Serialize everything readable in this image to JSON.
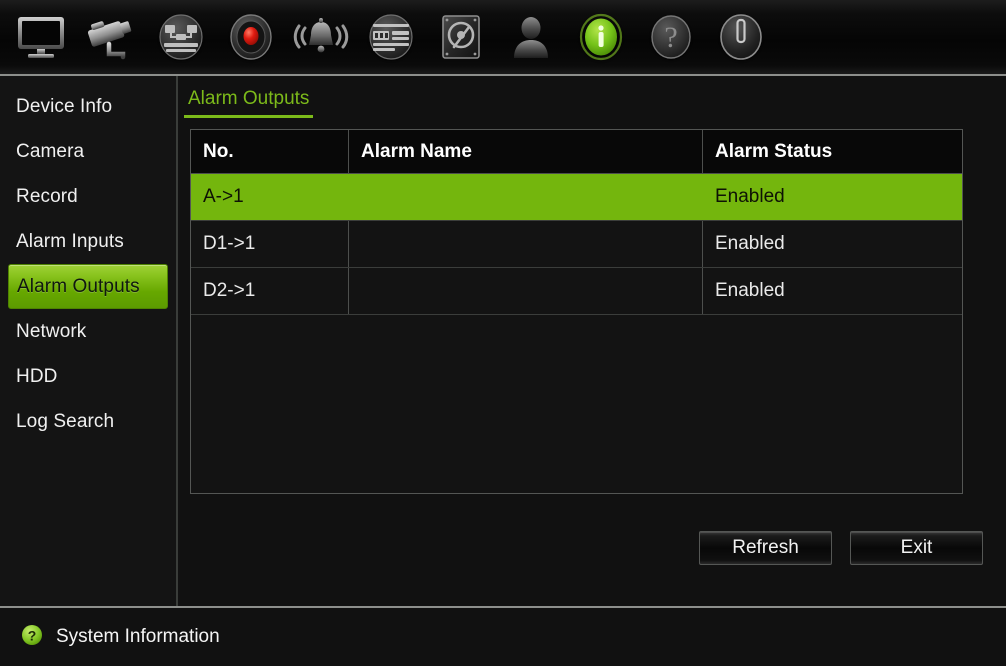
{
  "window": {
    "title": "Alarm Outputs"
  },
  "toolbar": {
    "items": [
      {
        "icon": "monitor-icon",
        "name": "display",
        "active": false
      },
      {
        "icon": "camera-icon",
        "name": "camera",
        "active": false
      },
      {
        "icon": "network-icon",
        "name": "network",
        "active": false
      },
      {
        "icon": "record-icon",
        "name": "record",
        "active": false
      },
      {
        "icon": "alarm-icon",
        "name": "alarm",
        "active": false
      },
      {
        "icon": "settings-icon",
        "name": "settings",
        "active": false
      },
      {
        "icon": "hdd-icon",
        "name": "hdd",
        "active": false
      },
      {
        "icon": "user-icon",
        "name": "user",
        "active": false
      },
      {
        "icon": "info-icon",
        "name": "system-info",
        "active": true
      },
      {
        "icon": "help-icon",
        "name": "help",
        "active": false
      },
      {
        "icon": "power-icon",
        "name": "shutdown",
        "active": false
      }
    ]
  },
  "sidebar": {
    "items": [
      {
        "label": "Device Info",
        "selected": false
      },
      {
        "label": "Camera",
        "selected": false
      },
      {
        "label": "Record",
        "selected": false
      },
      {
        "label": "Alarm Inputs",
        "selected": false
      },
      {
        "label": "Alarm Outputs",
        "selected": true
      },
      {
        "label": "Network",
        "selected": false
      },
      {
        "label": "HDD",
        "selected": false
      },
      {
        "label": "Log Search",
        "selected": false
      }
    ]
  },
  "main": {
    "tabs": [
      {
        "label": "Alarm Outputs",
        "active": true
      }
    ],
    "table": {
      "columns": [
        "No.",
        "Alarm Name",
        "Alarm Status"
      ],
      "rows": [
        {
          "no": "A->1",
          "alarm_name": "",
          "alarm_status": "Enabled",
          "selected": true
        },
        {
          "no": "D1->1",
          "alarm_name": "",
          "alarm_status": "Enabled",
          "selected": false
        },
        {
          "no": "D2->1",
          "alarm_name": "",
          "alarm_status": "Enabled",
          "selected": false
        }
      ]
    },
    "buttons": {
      "refresh_label": "Refresh",
      "exit_label": "Exit"
    }
  },
  "statusbar": {
    "icon": "help-circle-icon",
    "text": "System Information"
  },
  "colors": {
    "accent_green": "#74b60d",
    "tab_green": "#7cba1a",
    "sidebar_selected_green": "#8bc520",
    "background": "#111111",
    "toolbar_background": "#0d0d0d",
    "border": "#545654",
    "text": "#eaeaea"
  }
}
